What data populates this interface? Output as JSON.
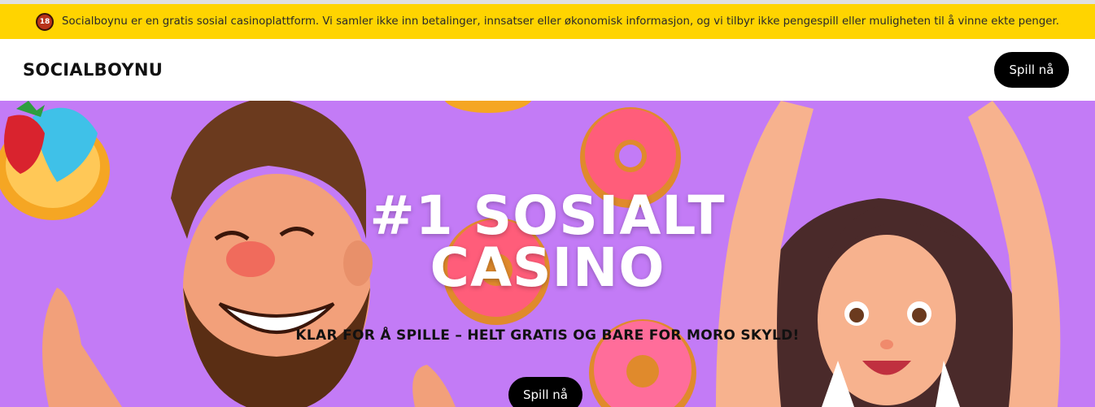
{
  "notice": {
    "age_label": "18",
    "text": "Socialboynu er en gratis sosial casinoplattform. Vi samler ikke inn betalinger, innsatser eller økonomisk informasjon, og vi tilbyr ikke pengespill eller muligheten til å vinne ekte penger."
  },
  "header": {
    "logo": "SOCIALBOYNU",
    "cta_label": "Spill nå"
  },
  "hero": {
    "title_line1": "#1 SOSIALT",
    "title_line2": "CASINO",
    "subtitle": "KLAR FOR Å SPILLE – HELT GRATIS OG BARE FOR MORO SKYLD!",
    "cta_label": "Spill nå"
  },
  "colors": {
    "notice_bg": "#ffd400",
    "hero_bg": "#c37bf6",
    "button_bg": "#000000"
  }
}
